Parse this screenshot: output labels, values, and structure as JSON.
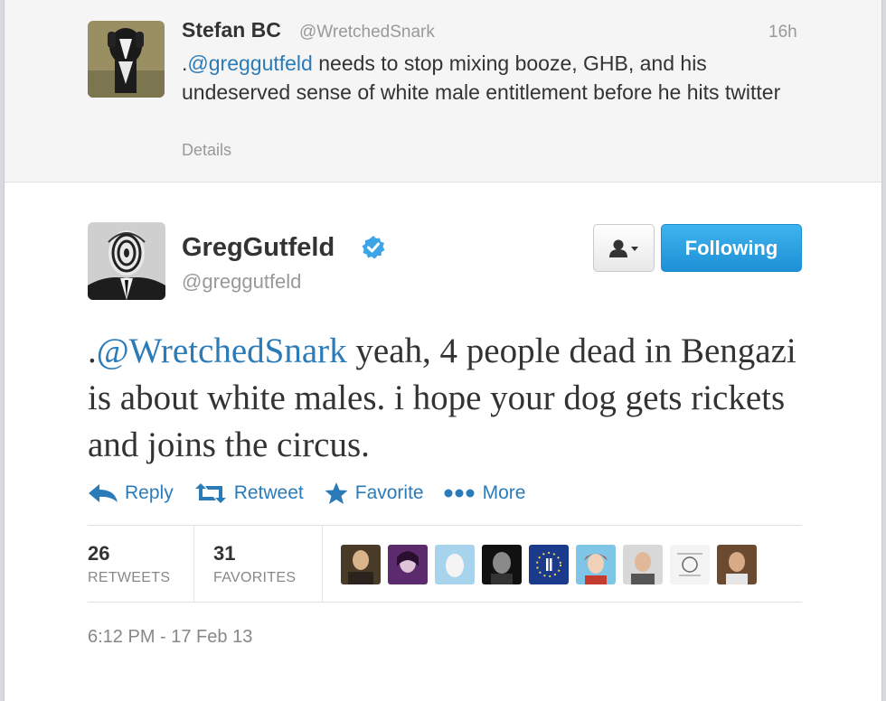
{
  "parent_tweet": {
    "name": "Stefan BC",
    "handle": "@WretchedSnark",
    "time": "16h",
    "text_prefix": ".",
    "mention": "@greggutfeld",
    "text_rest": " needs to stop mixing booze, GHB, and his undeserved sense of white male entitlement before he hits twitter",
    "details_label": "Details",
    "avatar_icon": "dog-avatar"
  },
  "main_tweet": {
    "name": "GregGutfeld",
    "handle": "@greggutfeld",
    "verified_icon": "verified-badge-icon",
    "text_prefix": ".",
    "mention": "@WretchedSnark",
    "text_rest": " yeah, 4 people dead in Bengazi is about white males. i hope your dog gets rickets and joins the circus.",
    "avatar_icon": "masked-man-avatar",
    "timestamp": "6:12 PM - 17 Feb 13"
  },
  "buttons": {
    "user_dropdown_icon": "user-dropdown-icon",
    "following_label": "Following"
  },
  "actions": [
    {
      "label": "Reply",
      "icon": "reply-icon"
    },
    {
      "label": "Retweet",
      "icon": "retweet-icon"
    },
    {
      "label": "Favorite",
      "icon": "star-icon"
    },
    {
      "label": "More",
      "icon": "more-dots-icon"
    }
  ],
  "stats": {
    "retweets_count": "26",
    "retweets_label": "RETWEETS",
    "favorites_count": "31",
    "favorites_label": "FAVORITES"
  },
  "colors": {
    "link": "#2b7bb9",
    "follow_button": "#1e90d6",
    "verified": "#3da4e8"
  }
}
